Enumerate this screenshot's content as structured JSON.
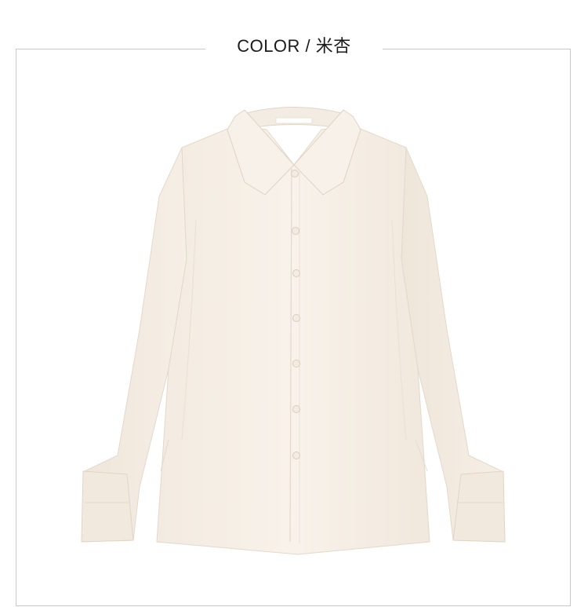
{
  "header": {
    "color_label": "COLOR",
    "separator": " / ",
    "color_name": "米杏"
  },
  "product": {
    "image_icon": "shirt-icon",
    "fabric_color": "#f6efe6",
    "shadow_color": "#e6dccf",
    "button_color": "#f3ede5"
  }
}
